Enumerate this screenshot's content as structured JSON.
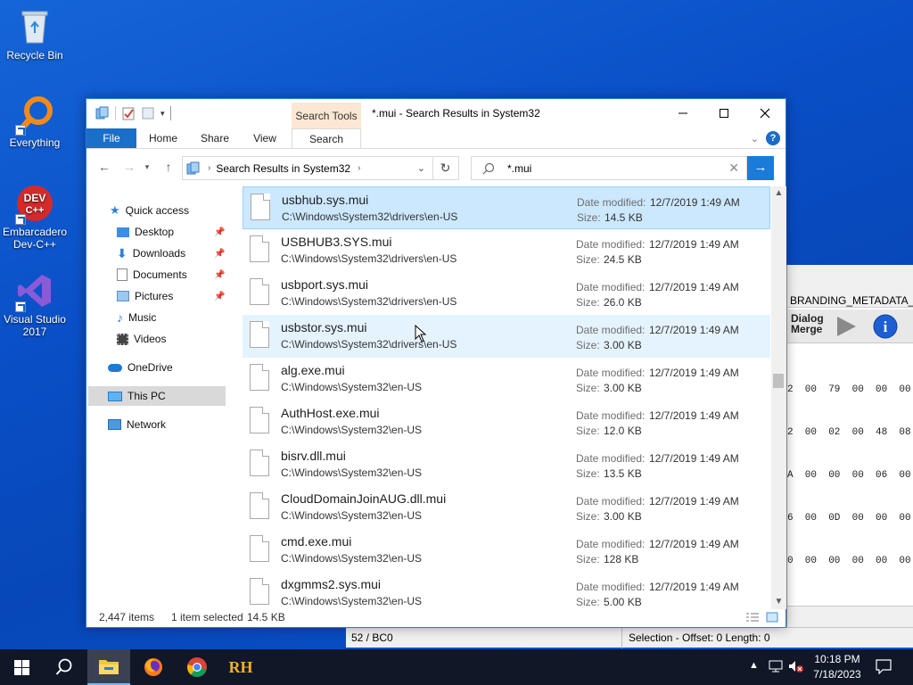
{
  "desktop": {
    "icons": [
      {
        "label": "Recycle Bin"
      },
      {
        "label": "Everything"
      },
      {
        "label": "Embarcadero Dev-C++"
      },
      {
        "label": "Visual Studio 2017"
      }
    ]
  },
  "background_app": {
    "title_fragment": "BRANDING_METADATA_R",
    "toolbar_button": "Dialog Merge",
    "hex_lines": [
      "2  00  79  00  00  00",
      "2  00  02  00  48  08",
      "A  00  00  00  06  00",
      "6  00  0D  00  00  00",
      "0  00  00  00  00  00"
    ],
    "status_position": "52 / BC0",
    "status_selection": "Selection - Offset: 0 Length: 0"
  },
  "explorer": {
    "title": "*.mui - Search Results in System32",
    "context_tab": "Search Tools",
    "ribbon_tabs": {
      "file": "File",
      "home": "Home",
      "share": "Share",
      "view": "View",
      "search": "Search"
    },
    "address": {
      "crumb": "Search Results in System32"
    },
    "search": {
      "query": "*.mui"
    },
    "nav": {
      "quick_access": "Quick access",
      "desktop": "Desktop",
      "downloads": "Downloads",
      "documents": "Documents",
      "pictures": "Pictures",
      "music": "Music",
      "videos": "Videos",
      "onedrive": "OneDrive",
      "this_pc": "This PC",
      "network": "Network"
    },
    "labels": {
      "date_modified": "Date modified:",
      "size": "Size:"
    },
    "files": [
      {
        "name": "usbhub.sys.mui",
        "path": "C:\\Windows\\System32\\drivers\\en-US",
        "date": "12/7/2019 1:49 AM",
        "size": "14.5 KB"
      },
      {
        "name": "USBHUB3.SYS.mui",
        "path": "C:\\Windows\\System32\\drivers\\en-US",
        "date": "12/7/2019 1:49 AM",
        "size": "24.5 KB"
      },
      {
        "name": "usbport.sys.mui",
        "path": "C:\\Windows\\System32\\drivers\\en-US",
        "date": "12/7/2019 1:49 AM",
        "size": "26.0 KB"
      },
      {
        "name": "usbstor.sys.mui",
        "path": "C:\\Windows\\System32\\drivers\\en-US",
        "date": "12/7/2019 1:49 AM",
        "size": "3.00 KB"
      },
      {
        "name": "alg.exe.mui",
        "path": "C:\\Windows\\System32\\en-US",
        "date": "12/7/2019 1:49 AM",
        "size": "3.00 KB"
      },
      {
        "name": "AuthHost.exe.mui",
        "path": "C:\\Windows\\System32\\en-US",
        "date": "12/7/2019 1:49 AM",
        "size": "12.0 KB"
      },
      {
        "name": "bisrv.dll.mui",
        "path": "C:\\Windows\\System32\\en-US",
        "date": "12/7/2019 1:49 AM",
        "size": "13.5 KB"
      },
      {
        "name": "CloudDomainJoinAUG.dll.mui",
        "path": "C:\\Windows\\System32\\en-US",
        "date": "12/7/2019 1:49 AM",
        "size": "3.00 KB"
      },
      {
        "name": "cmd.exe.mui",
        "path": "C:\\Windows\\System32\\en-US",
        "date": "12/7/2019 1:49 AM",
        "size": "128 KB"
      },
      {
        "name": "dxgmms2.sys.mui",
        "path": "C:\\Windows\\System32\\en-US",
        "date": "12/7/2019 1:49 AM",
        "size": "5.00 KB"
      }
    ],
    "status": {
      "items": "2,447 items",
      "selected": "1 item selected",
      "selected_size": "14.5 KB"
    }
  },
  "taskbar": {
    "rh_label": "RH",
    "clock_time": "10:18 PM",
    "clock_date": "7/18/2023"
  },
  "colors": {
    "accent": "#1a6fc9",
    "selection": "#cce8ff",
    "taskbar": "#101727"
  }
}
